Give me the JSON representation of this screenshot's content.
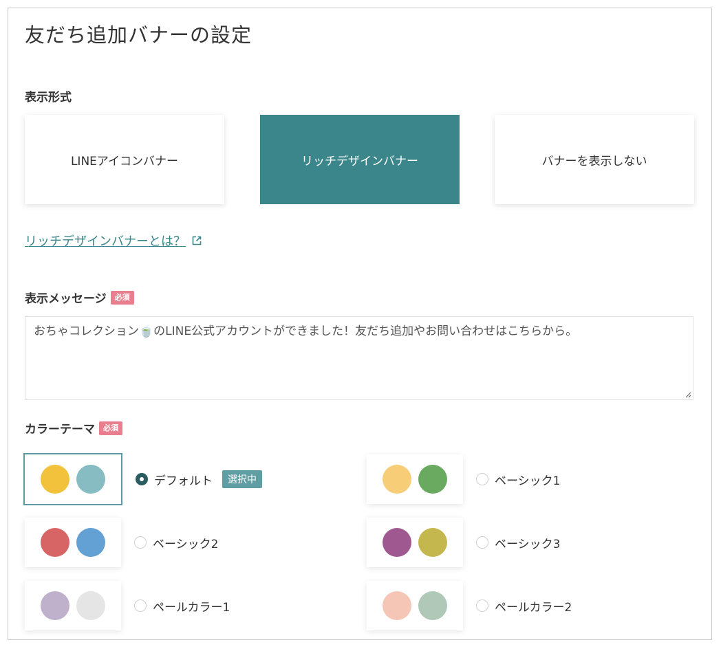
{
  "page_title": "友だち追加バナーの設定",
  "display_format": {
    "label": "表示形式",
    "options": [
      {
        "label": "LINEアイコンバナー",
        "selected": false
      },
      {
        "label": "リッチデザインバナー",
        "selected": true
      },
      {
        "label": "バナーを表示しない",
        "selected": false
      }
    ],
    "help_link": "リッチデザインバナーとは？"
  },
  "message": {
    "label": "表示メッセージ",
    "required_badge": "必須",
    "value": "おちゃコレクション🍵のLINE公式アカウントができました！友だち追加やお問い合わせはこちらから。"
  },
  "color_theme": {
    "label": "カラーテーマ",
    "required_badge": "必須",
    "selected_badge": "選択中",
    "themes": [
      {
        "label": "デフォルト",
        "colors": [
          "#f2c23d",
          "#86bcc2"
        ],
        "selected": true
      },
      {
        "label": "ベーシック1",
        "colors": [
          "#f7cd78",
          "#6aaa60"
        ],
        "selected": false
      },
      {
        "label": "ベーシック2",
        "colors": [
          "#d76565",
          "#63a0d3"
        ],
        "selected": false
      },
      {
        "label": "ベーシック3",
        "colors": [
          "#a05990",
          "#c4b74e"
        ],
        "selected": false
      },
      {
        "label": "ペールカラー1",
        "colors": [
          "#bfb0cc",
          "#e5e5e5"
        ],
        "selected": false
      },
      {
        "label": "ペールカラー2",
        "colors": [
          "#f5c5b6",
          "#afc8b8"
        ],
        "selected": false
      }
    ]
  },
  "colors": {
    "accent": "#3a868a",
    "required": "#e87e8e"
  }
}
